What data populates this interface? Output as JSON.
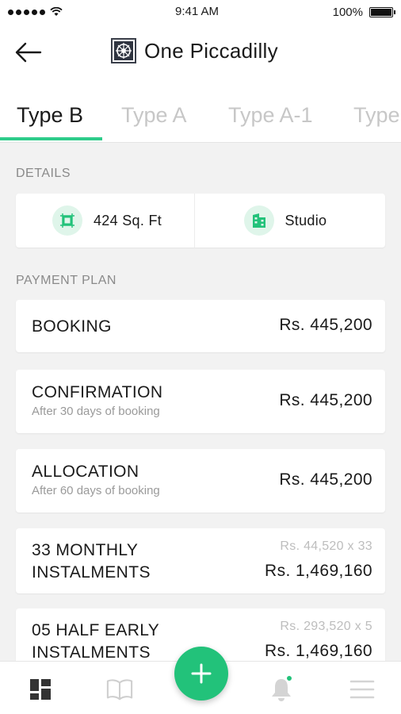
{
  "status_bar": {
    "time": "9:41 AM",
    "battery_label": "100%",
    "wifi_icon": "wifi-icon",
    "battery_icon": "battery-icon"
  },
  "header": {
    "title": "One Piccadilly",
    "back_icon": "arrow-left-icon",
    "logo_icon": "project-logo-icon"
  },
  "tabs": [
    {
      "label": "Type B",
      "active": true
    },
    {
      "label": "Type A",
      "active": false
    },
    {
      "label": "Type A-1",
      "active": false
    },
    {
      "label": "Type",
      "active": false
    }
  ],
  "details": {
    "section_label": "DETAILS",
    "area": {
      "label": "424 Sq. Ft",
      "icon": "area-icon"
    },
    "unit_type": {
      "label": "Studio",
      "icon": "building-icon"
    }
  },
  "payment_plan": {
    "section_label": "PAYMENT PLAN",
    "items": [
      {
        "name_line1": "BOOKING",
        "name_line2": "",
        "subtitle": "",
        "calc": "",
        "amount": "Rs. 445,200"
      },
      {
        "name_line1": "CONFIRMATION",
        "name_line2": "",
        "subtitle": "After 30 days of booking",
        "calc": "",
        "amount": "Rs. 445,200"
      },
      {
        "name_line1": "ALLOCATION",
        "name_line2": "",
        "subtitle": "After 60 days of booking",
        "calc": "",
        "amount": "Rs. 445,200"
      },
      {
        "name_line1": "33 MONTHLY",
        "name_line2": "INSTALMENTS",
        "subtitle": "",
        "calc": "Rs. 44,520 x 33",
        "amount": "Rs. 1,469,160"
      },
      {
        "name_line1": "05 HALF EARLY",
        "name_line2": "INSTALMENTS",
        "subtitle": "",
        "calc": "Rs. 293,520 x 5",
        "amount": "Rs. 1,469,160"
      }
    ]
  },
  "bottom_nav": {
    "items": [
      "dashboard-icon",
      "book-icon",
      "bell-icon",
      "menu-icon"
    ],
    "fab_label": "+",
    "accent_color": "#22c27a"
  }
}
